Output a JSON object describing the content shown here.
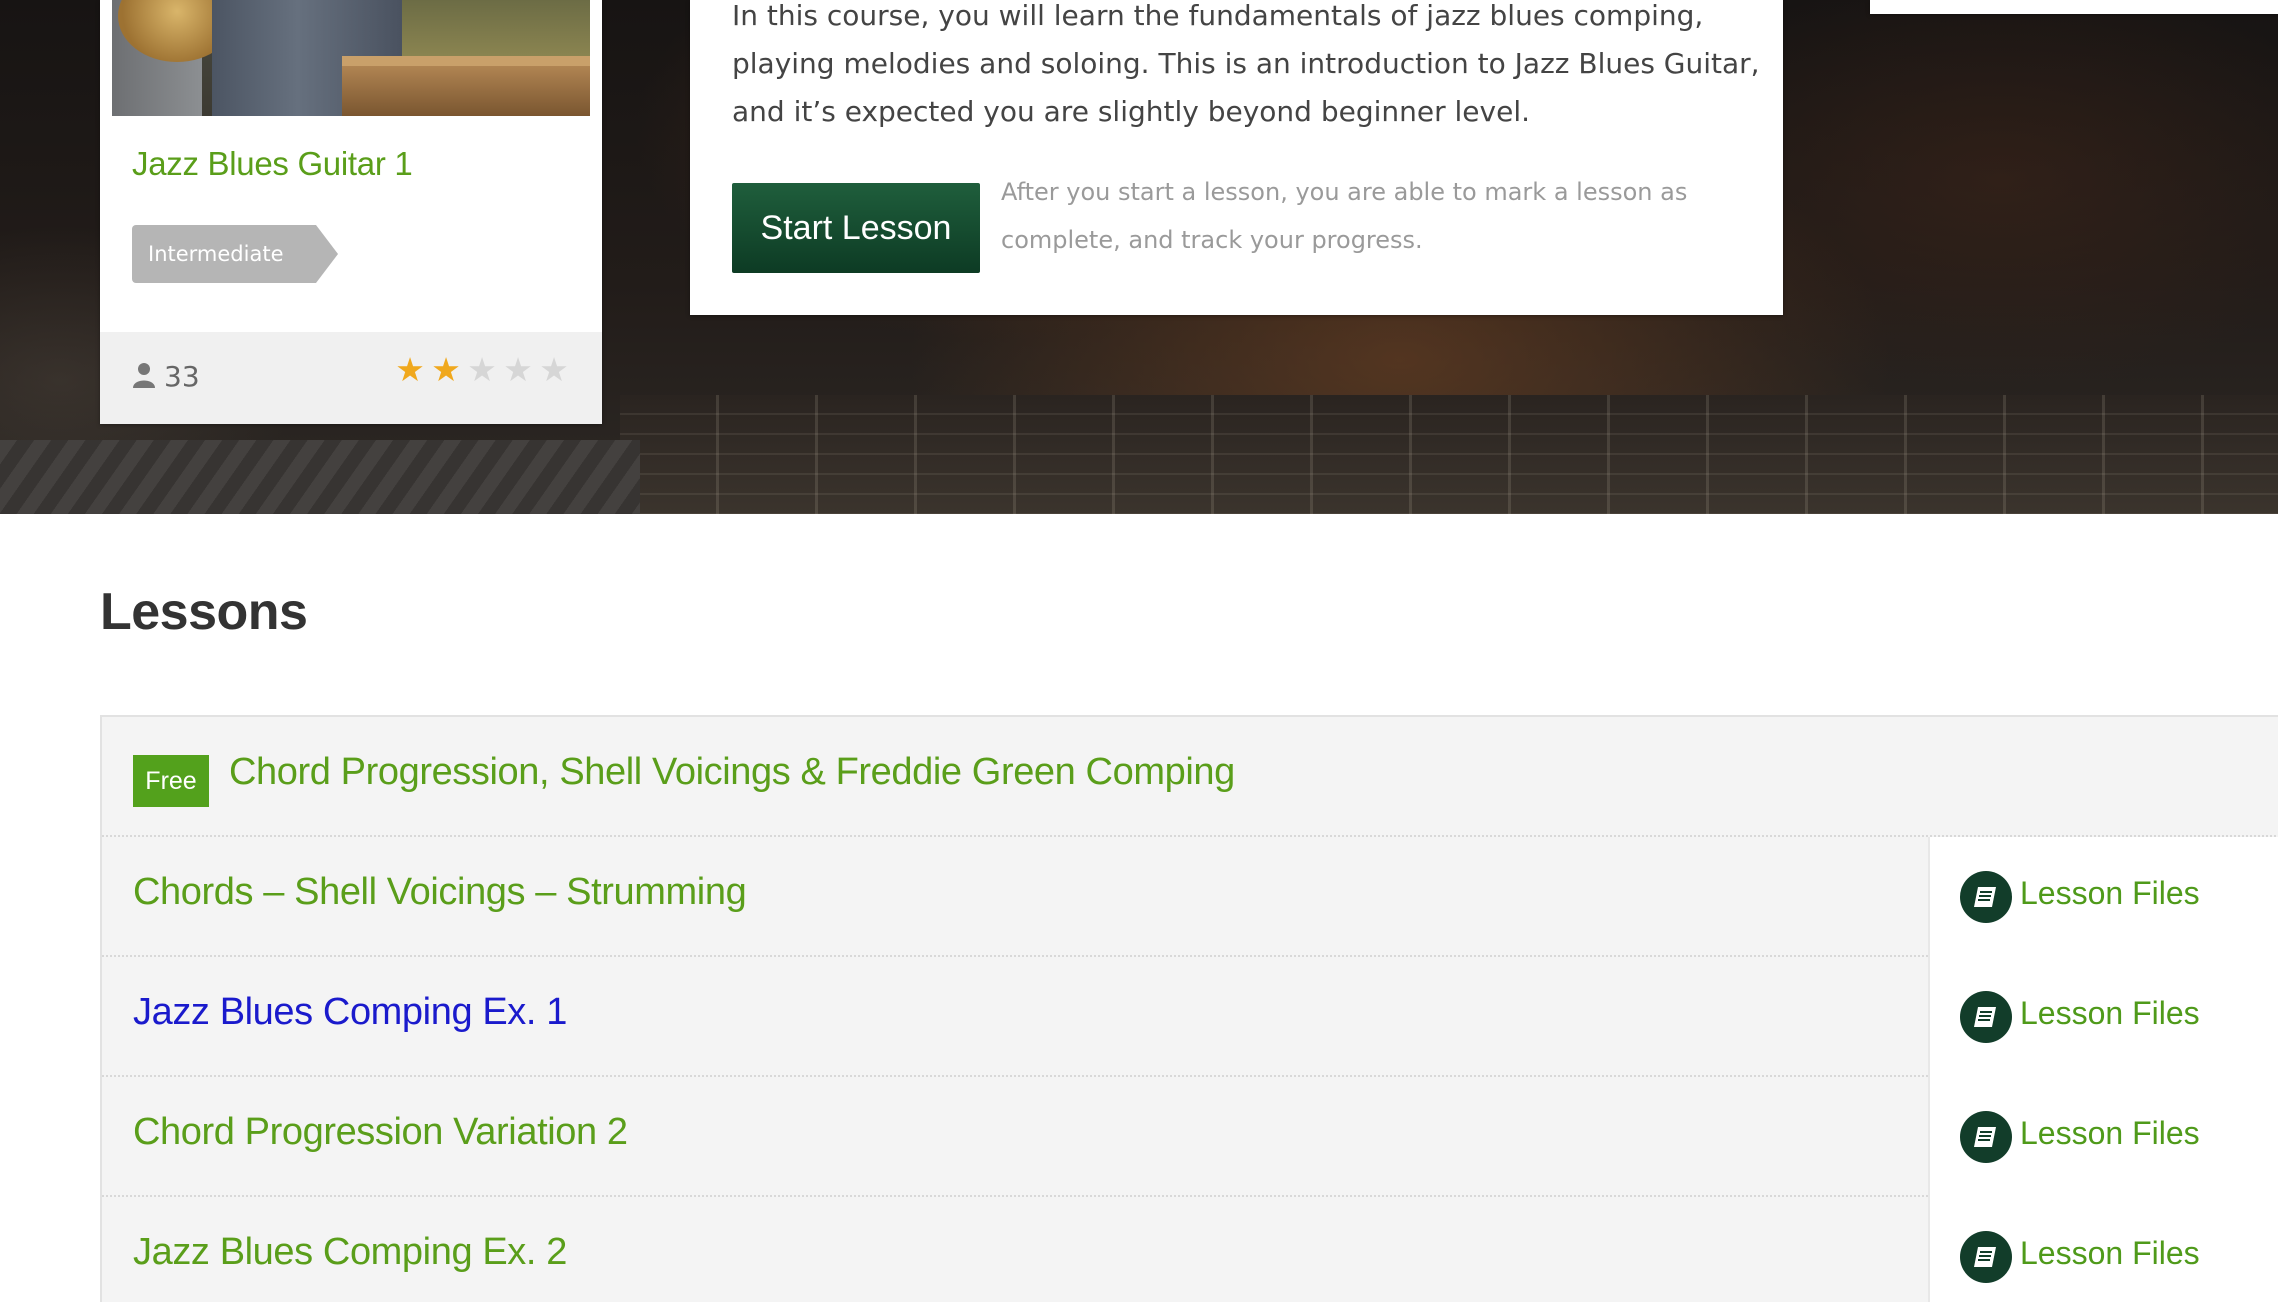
{
  "course": {
    "title": "Jazz Blues Guitar 1",
    "level": "Intermediate",
    "students": "33",
    "rating": 2,
    "rating_max": 5
  },
  "description": {
    "line1": "In this course, you will learn the fundamentals of jazz blues comping,",
    "line2": "playing melodies and soloing. This is an introduction to Jazz Blues Guitar,",
    "line3": "and it’s expected you are slightly beyond beginner level.",
    "start_button": "Start Lesson",
    "start_note_line1": "After you start a lesson, you are able to mark a lesson as",
    "start_note_line2": "complete, and track your progress."
  },
  "lessons": {
    "heading": "Lessons",
    "free_badge": "Free",
    "files_label": "Lesson Files",
    "items": [
      {
        "title": "Chord Progression, Shell Voicings & Freddie Green Comping"
      },
      {
        "title": "Chords – Shell Voicings – Strumming"
      },
      {
        "title": "Jazz Blues Comping Ex. 1"
      },
      {
        "title": "Chord Progression Variation 2"
      },
      {
        "title": "Jazz Blues Comping Ex. 2"
      }
    ]
  },
  "colors": {
    "accent_green": "#5a9e1a",
    "button_dark_green": "#0d3b24",
    "visited_link": "#1a1acc",
    "star": "#f0a81d"
  },
  "icons": [
    "user-icon",
    "star-icon",
    "book-icon"
  ]
}
